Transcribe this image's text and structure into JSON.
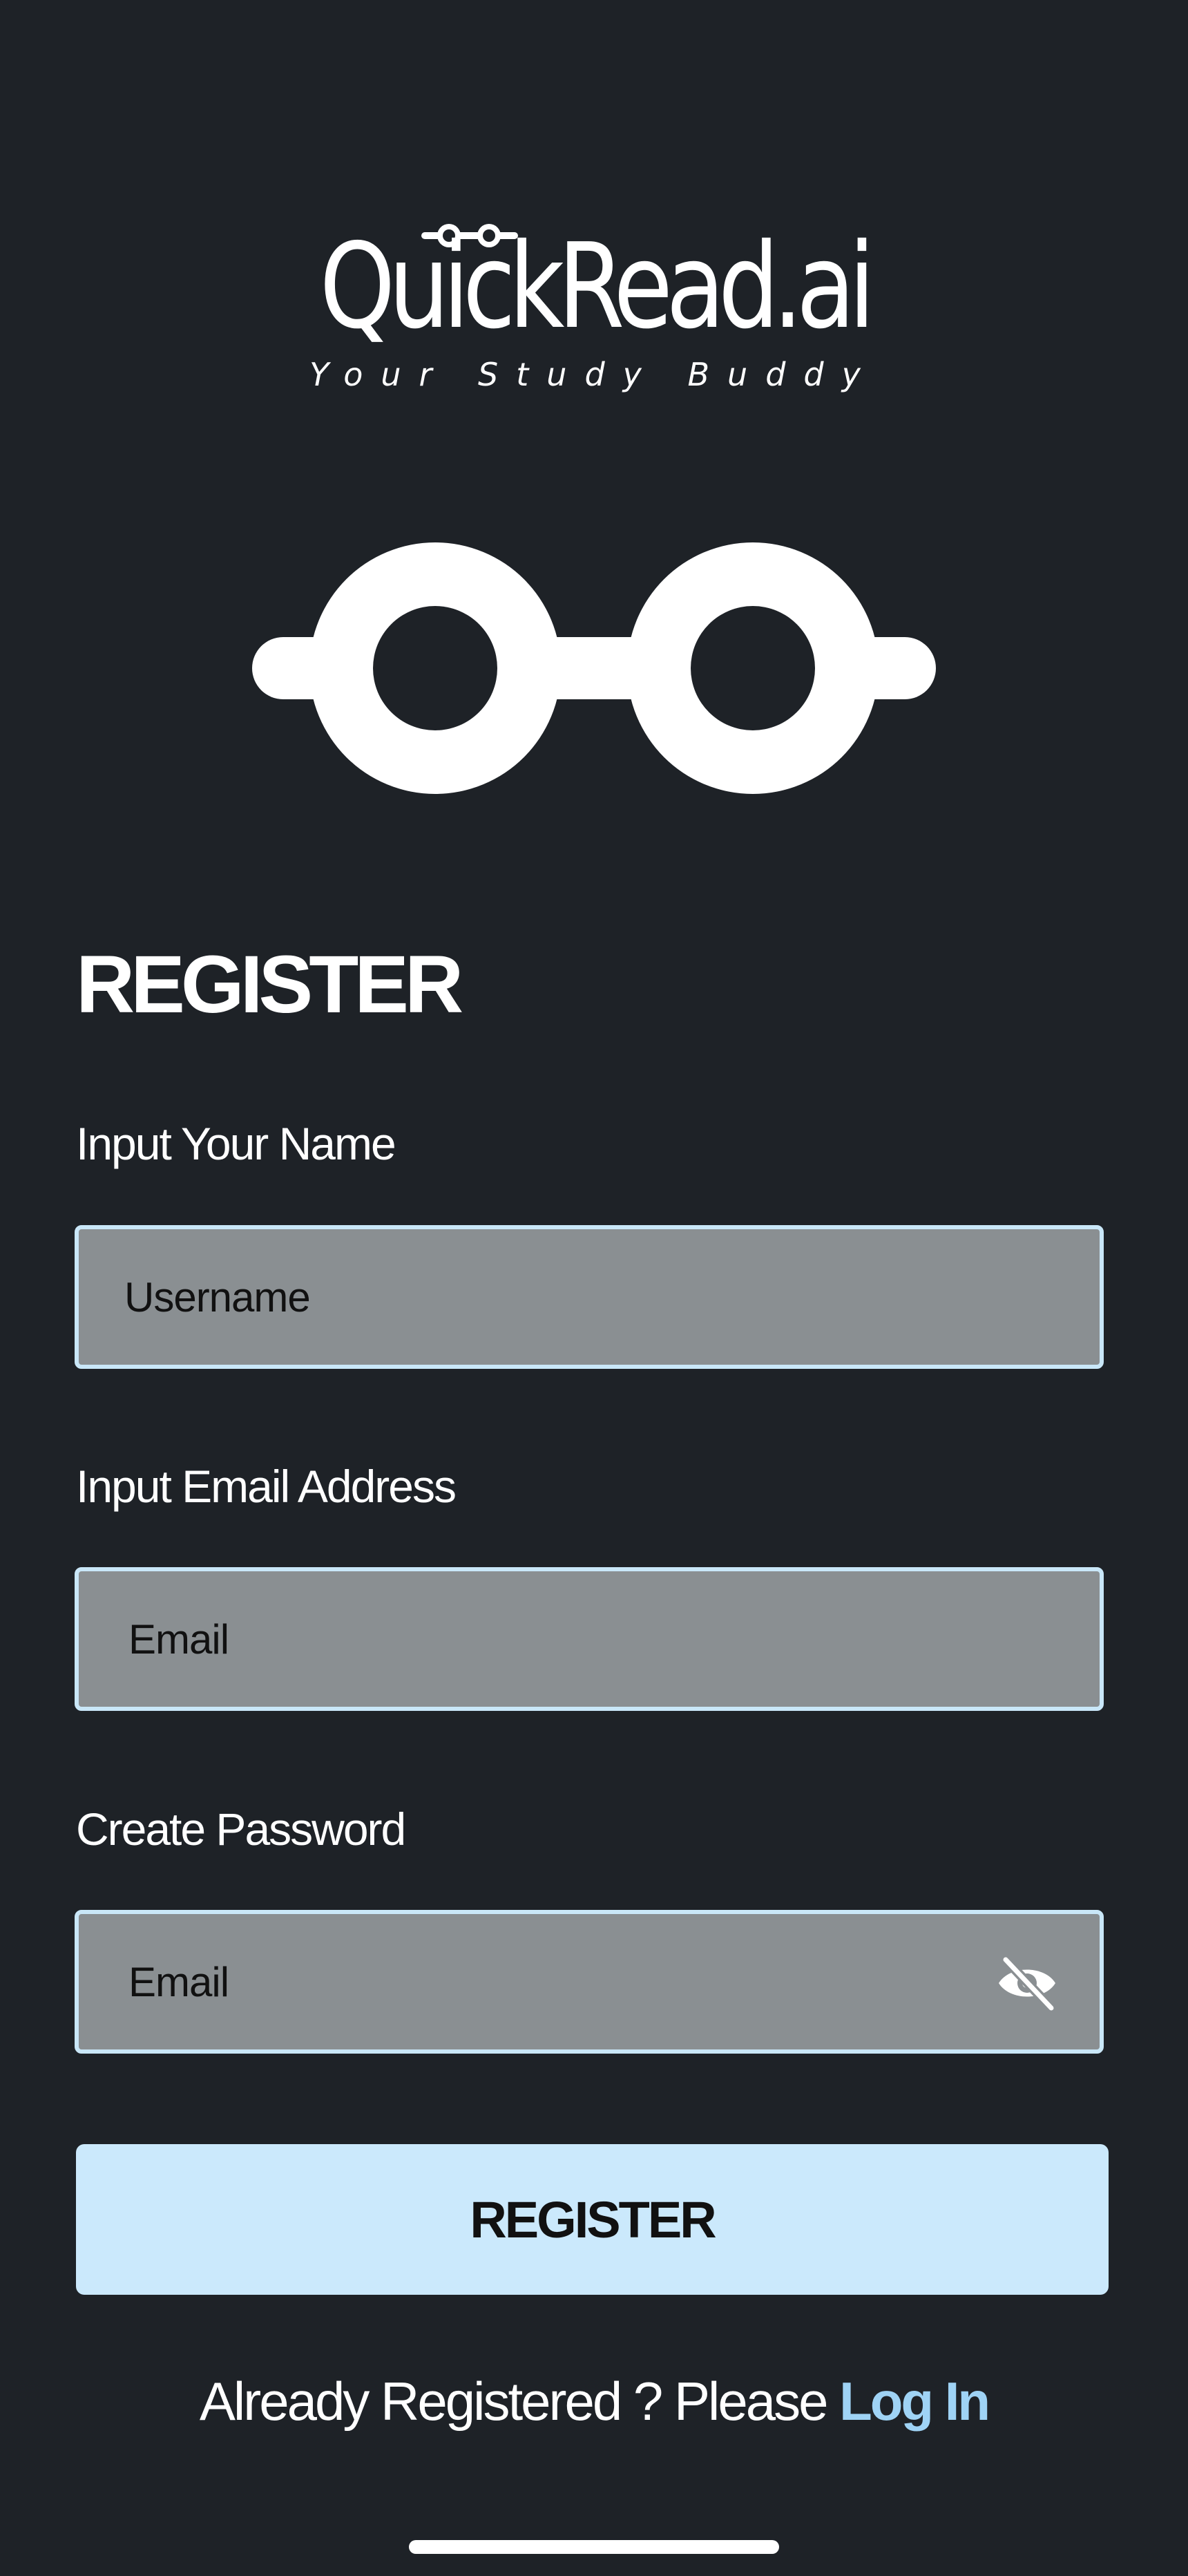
{
  "app": {
    "brand_name": "QuickRead.ai",
    "tagline": "Your Study Buddy"
  },
  "form": {
    "title": "REGISTER",
    "name_label": "Input Your Name",
    "name_placeholder": "Username",
    "email_label": "Input Email Address",
    "email_placeholder": "Email",
    "password_label": "Create Password",
    "password_placeholder": "Email",
    "password_toggle_icon": "eye-slash-icon",
    "submit_label": "REGISTER"
  },
  "footer": {
    "prompt_text": "Already Registered  ? Please ",
    "login_link": "Log In"
  },
  "colors": {
    "background": "#1e2227",
    "field_fill": "#8a8f92",
    "field_border": "#c9e7f8",
    "button_fill": "#cbe9fc",
    "link": "#9fd3f5"
  }
}
